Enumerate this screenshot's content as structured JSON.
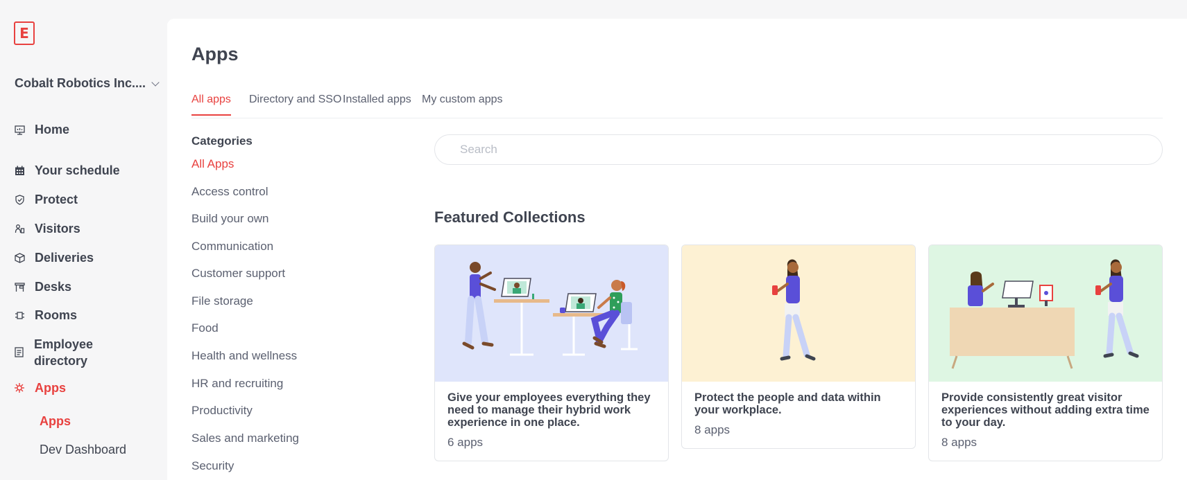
{
  "sidebar": {
    "logo_letter": "E",
    "org_name": "Cobalt Robotics Inc....",
    "items": [
      {
        "label": "Home",
        "icon": "home-icon"
      },
      {
        "label": "Your schedule",
        "icon": "calendar-icon"
      },
      {
        "label": "Protect",
        "icon": "shield-icon"
      },
      {
        "label": "Visitors",
        "icon": "visitors-icon"
      },
      {
        "label": "Deliveries",
        "icon": "package-icon"
      },
      {
        "label": "Desks",
        "icon": "desk-icon"
      },
      {
        "label": "Rooms",
        "icon": "room-icon"
      },
      {
        "label": "Employee directory",
        "icon": "directory-icon"
      },
      {
        "label": "Apps",
        "icon": "apps-icon"
      }
    ],
    "active_item": "Apps",
    "sub_items": [
      {
        "label": "Apps"
      },
      {
        "label": "Dev Dashboard"
      }
    ]
  },
  "header": {
    "title": "Apps"
  },
  "tabs": [
    {
      "label": "All apps"
    },
    {
      "label": "Directory and SSO"
    },
    {
      "label": "Installed apps"
    },
    {
      "label": "My custom apps"
    }
  ],
  "categories": {
    "title": "Categories",
    "items": [
      "All Apps",
      "Access control",
      "Build your own",
      "Communication",
      "Customer support",
      "File storage",
      "Food",
      "Health and wellness",
      "HR and recruiting",
      "Productivity",
      "Sales and marketing",
      "Security"
    ]
  },
  "search": {
    "placeholder": "Search",
    "value": ""
  },
  "featured": {
    "title": "Featured Collections",
    "cards": [
      {
        "title": "Give your employees everything they need to manage their hybrid work experience in one place.",
        "count": "6 apps",
        "bg": "#dfe5fb"
      },
      {
        "title": "Protect the people and data within your workplace.",
        "count": "8 apps",
        "bg": "#fdf1d3"
      },
      {
        "title": "Provide consistently great visitor experiences without adding extra time to your day.",
        "count": "8 apps",
        "bg": "#def6e3"
      }
    ]
  },
  "colors": {
    "accent": "#e8413f",
    "text": "#3f4450",
    "muted": "#5b6070",
    "indigo": "#5a4fd8"
  }
}
